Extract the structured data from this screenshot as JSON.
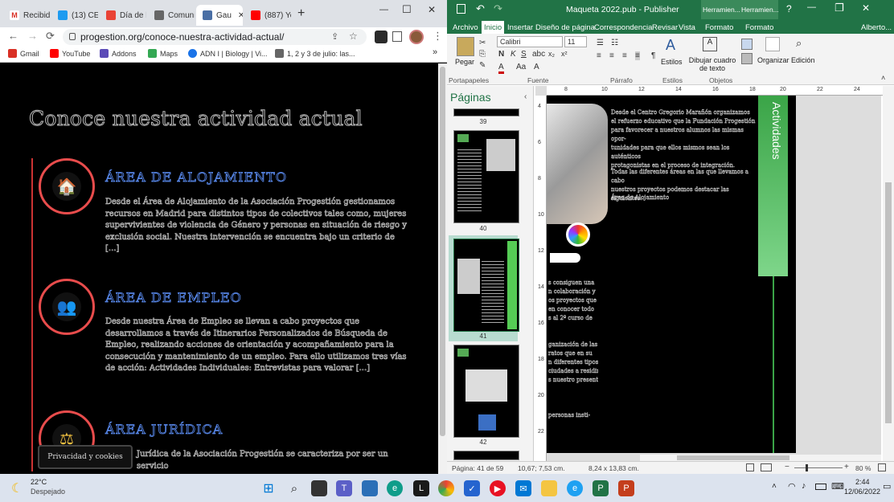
{
  "browser": {
    "tabs": [
      {
        "label": "Recibid",
        "icon": "gmail-icon",
        "color": "#d93025"
      },
      {
        "label": "(13) CE",
        "icon": "twitter-icon",
        "color": "#1d9bf0"
      },
      {
        "label": "Día de l",
        "icon": "flag-icon",
        "color": "#e94235"
      },
      {
        "label": "Comuni",
        "icon": "app-icon",
        "color": "#555555"
      },
      {
        "label": "Gau",
        "icon": "grid-icon",
        "color": "#4a6fa5"
      },
      {
        "label": "(887) Yo",
        "icon": "youtube-icon",
        "color": "#ff0000"
      }
    ],
    "new_tab": "+",
    "window_controls": {
      "minimize": "—",
      "maximize": "☐",
      "close": "✕"
    },
    "nav": {
      "back": "←",
      "forward": "→",
      "reload": "⟳"
    },
    "url": "progestion.org/conoce-nuestra-actividad-actual/",
    "bookmarks": [
      {
        "label": "Gmail",
        "icon": "gmail-icon"
      },
      {
        "label": "YouTube",
        "icon": "youtube-icon"
      },
      {
        "label": "Addons",
        "icon": "addons-icon"
      },
      {
        "label": "Maps",
        "icon": "maps-icon"
      },
      {
        "label": "ADN I | Biology | Vi...",
        "icon": "biology-icon"
      },
      {
        "label": "1, 2 y 3 de julio: las...",
        "icon": "calendar-icon"
      }
    ],
    "bookmarks_more": "»"
  },
  "page": {
    "title": "Conoce nuestra actividad actual",
    "areas": [
      {
        "title": "ÁREA DE ALOJAMIENTO",
        "icon": "house-icon",
        "glyph": "🏠",
        "text": "Desde el Área de Alojamiento de la Asociación Progestión gestionamos recursos en Madrid para distintos tipos de colectivos tales como, mujeres supervivientes de violencia de Género y personas en situación de riesgo y exclusión social. Nuestra intervención se encuentra bajo un criterio de [...]"
      },
      {
        "title": "ÁREA DE EMPLEO",
        "icon": "employment-icon",
        "glyph": "👥",
        "text": "Desde nuestra Área de Empleo se llevan a cabo proyectos que desarrollamos a través de Itinerarios Personalizados de Búsqueda de Empleo, realizando acciones de orientación y acompañamiento para la consecución y mantenimiento de un empleo. Para ello utilizamos tres vías de acción: Actividades Individuales: Entrevistas para valorar [...]"
      },
      {
        "title": "ÁREA JURÍDICA",
        "icon": "scales-icon",
        "glyph": "⚖",
        "text": "Jurídica de la Asociación Progestión se caracteriza por ser un servicio"
      }
    ],
    "cookie_label": "Privacidad y cookies"
  },
  "publisher": {
    "title": "Maqueta 2022.pub - Publisher",
    "context_tabs": [
      "Herramien...",
      "Herramien..."
    ],
    "user": "Alberto...",
    "tabs": [
      "Archivo",
      "Inicio",
      "Insertar",
      "Diseño de página",
      "Correspondencia",
      "Revisar",
      "Vista",
      "Formato",
      "Formato"
    ],
    "font_name": "Calibri",
    "font_size": "11",
    "groups": [
      "Portapapeles",
      "Fuente",
      "Párrafo",
      "Estilos",
      "Objetos"
    ],
    "buttons": {
      "paste": "Pegar",
      "styles": "Estilos",
      "draw_textbox": "Dibujar cuadro de texto",
      "organize": "Organizar",
      "edit": "Edición"
    },
    "pages_pane_title": "Páginas",
    "pages": [
      "39",
      "40",
      "41",
      "42"
    ],
    "ruler_h": [
      "8",
      "10",
      "12",
      "14",
      "16",
      "18",
      "20",
      "22",
      "24"
    ],
    "ruler_v": [
      "4",
      "6",
      "8",
      "10",
      "12",
      "14",
      "16",
      "18",
      "20",
      "22"
    ],
    "doc": {
      "side_label": "Actividades",
      "col1": [
        "Desde el Centro Gregorio Marañón organizamos",
        "el refuerzo educativo que la Fundación Progestión",
        "para favorecer a nuestros alumnos las mismas opor-",
        "tunidades para que ellos mismos sean los auténticos",
        "protagonistas en el proceso de integración."
      ],
      "col2": [
        "Todas las diferentes áreas en las que llevamos a cabo",
        "nuestros proyectos podemos destacar las siguientes:"
      ],
      "col3": [
        "Área de Alojamiento"
      ],
      "left_lines": [
        "s consiguen una",
        "n colaboración y",
        "os proyectos que",
        "en conocer todo",
        "s al 2º curso de",
        "",
        "",
        "ganización de las",
        "ratos que en su",
        "n diferentes tipos",
        "ciudades a residir",
        "s nuestro presentar",
        "",
        "",
        "",
        "personas insti-"
      ]
    },
    "status": {
      "page": "Página: 41 de 59",
      "pos": "10,67; 7,53 cm.",
      "size": "8,24 x 13,83 cm.",
      "zoom": "80 %"
    }
  },
  "taskbar": {
    "weather_temp": "22°C",
    "weather_desc": "Despejado",
    "time": "2:44",
    "date": "12/06/2022",
    "apps": [
      "windows-start",
      "search",
      "task-view",
      "teams",
      "store",
      "edge",
      "libreoffice",
      "chrome",
      "todo",
      "media",
      "mail",
      "explorer",
      "ie",
      "publisher",
      "powerpoint"
    ]
  }
}
